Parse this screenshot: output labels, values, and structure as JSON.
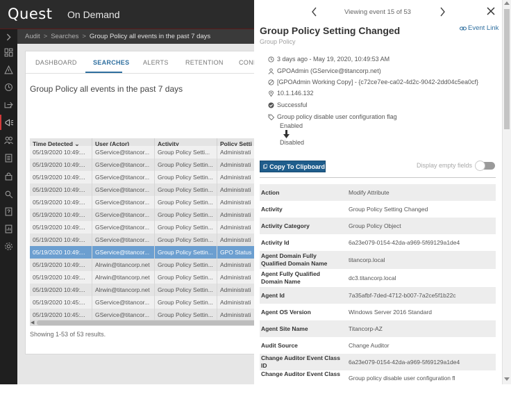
{
  "header": {
    "logo": "Quest",
    "app_name": "On Demand"
  },
  "breadcrumb": {
    "items": [
      "Audit",
      "Searches",
      "Group Policy all events in the past 7 days"
    ],
    "separator": ">"
  },
  "tabs": [
    {
      "label": "DASHBOARD",
      "active": false
    },
    {
      "label": "SEARCHES",
      "active": true
    },
    {
      "label": "ALERTS",
      "active": false
    },
    {
      "label": "RETENTION",
      "active": false
    },
    {
      "label": "CONF",
      "active": false
    }
  ],
  "search": {
    "title": "Group Policy all events in the past 7 days",
    "showing": "Showing 1-53 of 53 results."
  },
  "grid": {
    "columns": [
      "Time Detected",
      "User (Actor)",
      "Activity",
      "Policy Setti"
    ],
    "sort_indicator": "⌄",
    "rows": [
      [
        "05/19/2020 10:49:...",
        "GService@titancor...",
        "Group Policy Setti...",
        "Administrati"
      ],
      [
        "05/19/2020 10:49:...",
        "GService@titancor...",
        "Group Policy Settin...",
        "Administrati"
      ],
      [
        "05/19/2020 10:49:...",
        "GService@titancor...",
        "Group Policy Settin...",
        "Administrati"
      ],
      [
        "05/19/2020 10:49:...",
        "GService@titancor...",
        "Group Policy Settin...",
        "Administrati"
      ],
      [
        "05/19/2020 10:49:...",
        "GService@titancor...",
        "Group Policy Settin...",
        "Administrati"
      ],
      [
        "05/19/2020 10:49:...",
        "GService@titancor...",
        "Group Policy Settin...",
        "Administrati"
      ],
      [
        "05/19/2020 10:49:...",
        "GService@titancor...",
        "Group Policy Settin...",
        "Administrati"
      ],
      [
        "05/19/2020 10:49:...",
        "GService@titancor...",
        "Group Policy Settin...",
        "Administrati"
      ],
      [
        "05/19/2020 10:49:...",
        "GService@titancor...",
        "Group Policy Settin...",
        "GPO Status"
      ],
      [
        "05/19/2020 10:49:...",
        "Alrwin@titancorp.net",
        "Group Policy Settin...",
        "Administrati"
      ],
      [
        "05/19/2020 10:49:...",
        "Alrwin@titancorp.net",
        "Group Policy Settin...",
        "Administrati"
      ],
      [
        "05/19/2020 10:49:...",
        "Alrwin@titancorp.net",
        "Group Policy Settin...",
        "Administrati"
      ],
      [
        "05/19/2020 10:45:...",
        "GService@titancor...",
        "Group Policy Settin...",
        "Administrati"
      ],
      [
        "05/19/2020 10:45:...",
        "GService@titancor...",
        "Group Policy Settin...",
        "Administrati"
      ]
    ],
    "selected_row": 8
  },
  "event": {
    "viewing": "Viewing event 15 of 53",
    "title": "Group Policy Setting Changed",
    "subtitle": "Group Policy",
    "event_link": "Event Link",
    "time": "3 days ago - May 19, 2020, 10:49:53 AM",
    "actor": "GPOAdmin (GService@titancorp.net)",
    "target": "[GPOAdmin Working Copy] - {c72ce7ee-ca02-4d2c-9042-2dd04c5ea0cf}",
    "ip": "10.1.146.132",
    "status": "Successful",
    "setting": "Group policy disable user configuration flag",
    "old_value": "Enabled",
    "new_value": "Disabled",
    "copy_button": "Copy To Clipboard",
    "display_empty": "Display empty fields",
    "display_empty_on": false
  },
  "properties": [
    {
      "key": "Action",
      "value": "Modify Attribute"
    },
    {
      "key": "Activity",
      "value": "Group Policy Setting Changed"
    },
    {
      "key": "Activity Category",
      "value": "Group Policy Object"
    },
    {
      "key": "Activity Id",
      "value": "6a23e079-0154-42da-a969-5f69129a1de4"
    },
    {
      "key": "Agent Domain Fully Qualified Domain Name",
      "value": "titancorp.local"
    },
    {
      "key": "Agent Fully Qualified Domain Name",
      "value": "dc3.titancorp.local"
    },
    {
      "key": "Agent Id",
      "value": "7a35afbf-7ded-4712-b007-7a2ce5f1b22c"
    },
    {
      "key": "Agent OS Version",
      "value": "Windows Server 2016 Standard"
    },
    {
      "key": "Agent Site Name",
      "value": "Titancorp-AZ"
    },
    {
      "key": "Audit Source",
      "value": "Change Auditor"
    },
    {
      "key": "Change Auditor Event Class ID",
      "value": "6a23e079-0154-42da-a969-5f69129a1de4"
    },
    {
      "key": "Change Auditor Event Class",
      "value": "Group policy disable user configuration fl"
    }
  ],
  "colors": {
    "accent": "#2f6f9f",
    "button": "#1f5d8c",
    "selected_row": "#6c9fd0",
    "rail_active": "#d23b3b"
  },
  "rail_icons": [
    "chevron-right-icon",
    "dashboard-icon",
    "alert-triangle-icon",
    "history-icon",
    "export-icon",
    "megaphone-icon",
    "users-icon",
    "document-icon",
    "lock-icon",
    "gear-search-icon",
    "help-icon",
    "report-icon",
    "settings-icon"
  ]
}
